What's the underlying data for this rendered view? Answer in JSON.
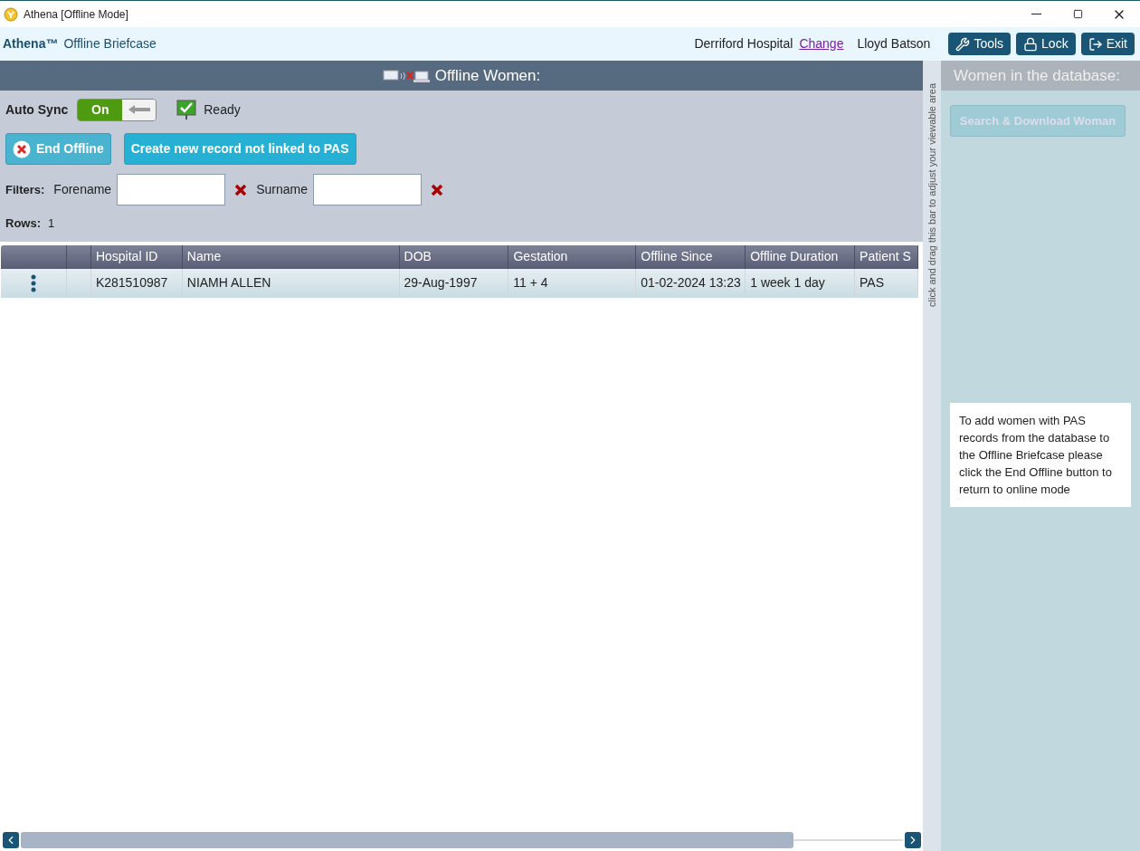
{
  "window": {
    "title": "Athena [Offline Mode]"
  },
  "header": {
    "brand": "Athena™",
    "subtitle": "Offline Briefcase",
    "hospital": "Derriford Hospital",
    "change_link": "Change",
    "user": "Lloyd Batson",
    "buttons": [
      {
        "kind": "tools",
        "label": "Tools"
      },
      {
        "kind": "lock",
        "label": "Lock"
      },
      {
        "kind": "exit",
        "label": "Exit"
      }
    ]
  },
  "left_panel": {
    "title": "Offline Women:",
    "auto_sync": {
      "label": "Auto Sync",
      "on": true,
      "on_label": "On"
    },
    "status": "Ready",
    "buttons": [
      {
        "kind": "end",
        "label": "End Offline"
      },
      {
        "kind": "create",
        "label": "Create new record not linked to PAS"
      }
    ],
    "filters": {
      "label": "Filters:",
      "fields": [
        {
          "label": "Forename"
        },
        {
          "label": "Surname"
        }
      ]
    },
    "rows_label": "Rows:",
    "rows_count": "1",
    "table": {
      "columns": [
        "",
        "",
        "Hospital ID",
        "Name",
        "DOB",
        "Gestation",
        "Offline Since",
        "Offline Duration",
        "Patient S"
      ],
      "rows": [
        {
          "cells": [
            "",
            "",
            "K281510987",
            "NIAMH ALLEN",
            "29-Aug-1997",
            "11 + 4",
            "01-02-2024 13:23",
            "1 week 1 day",
            "PAS"
          ]
        }
      ]
    }
  },
  "splitter": {
    "text": "click and drag this bar to adjust your viewable area"
  },
  "right_panel": {
    "title": "Women in the database:",
    "button": {
      "label": "Search & Download Woman",
      "disabled": true
    },
    "note": "To add women with PAS records from the database to the Offline Briefcase please click the End Offline button to return to online mode"
  }
}
